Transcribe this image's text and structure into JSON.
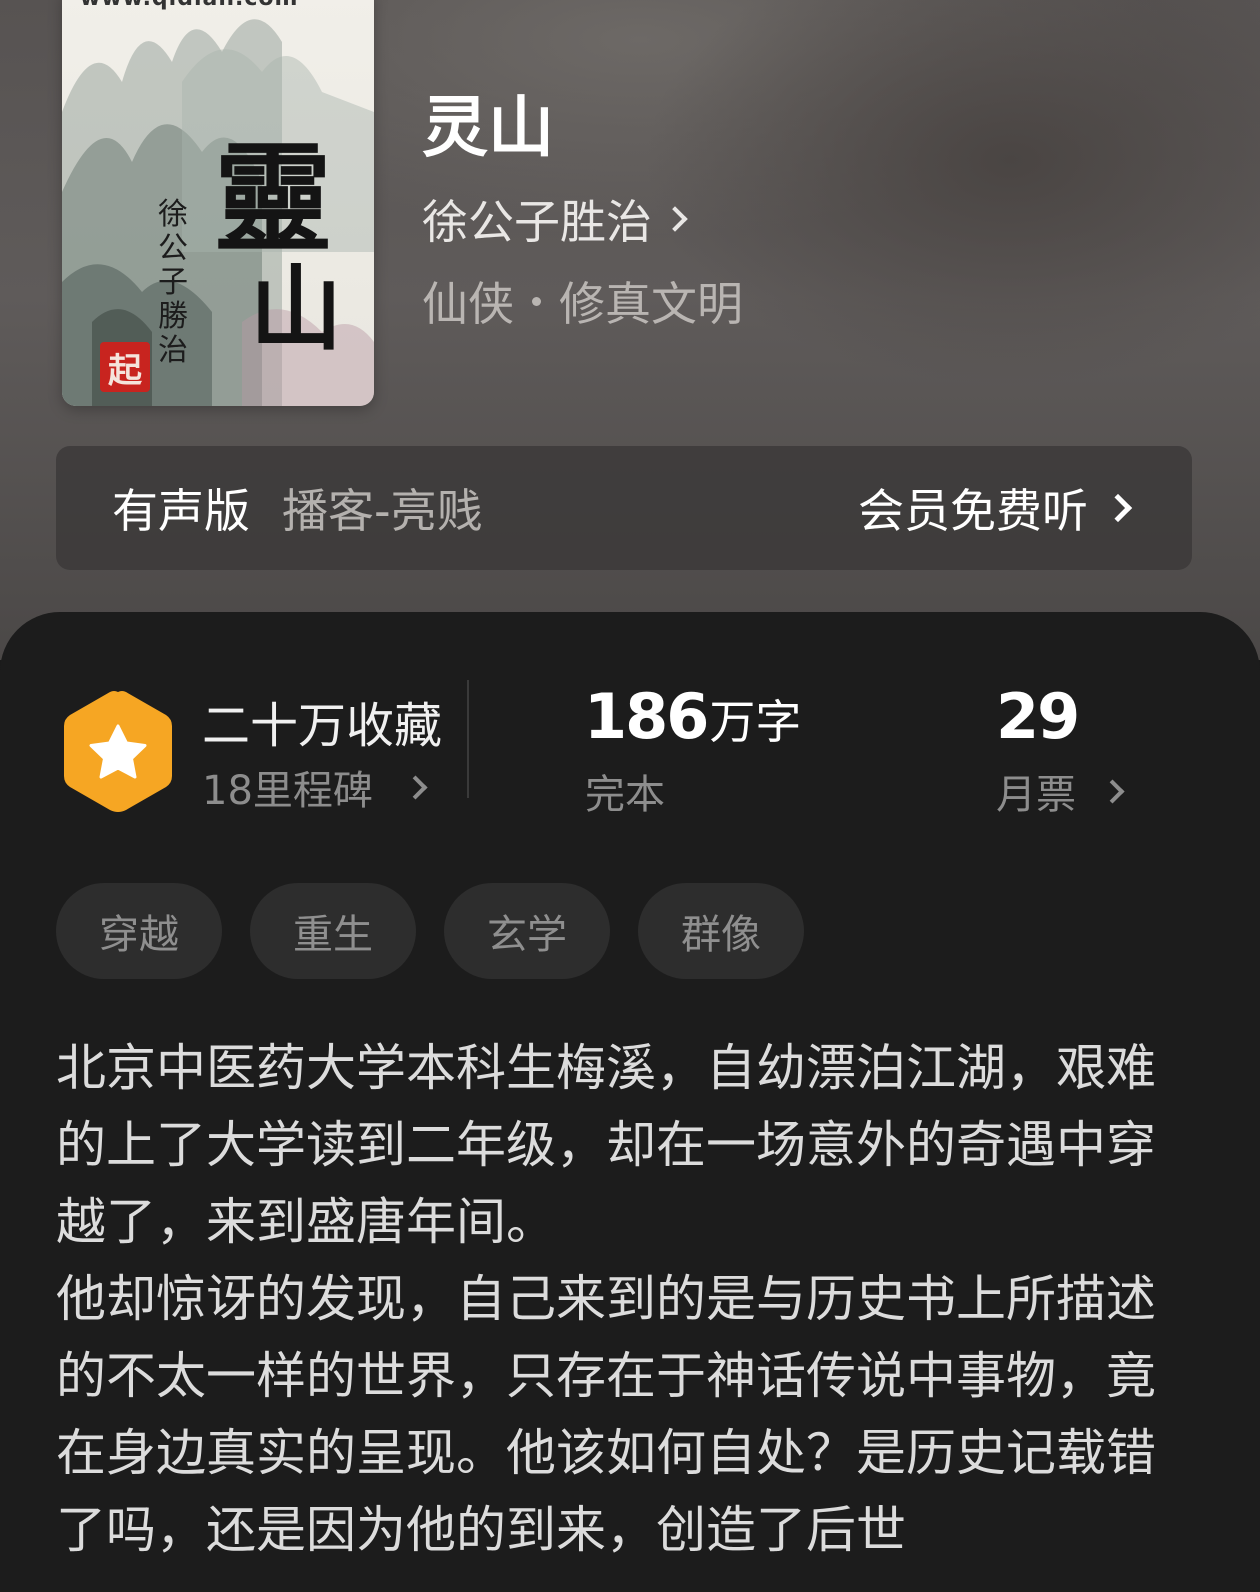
{
  "cover": {
    "site_text": "www.qidian.com",
    "title_line1": "靈",
    "title_line2": "山",
    "author_vertical": "徐公子勝治",
    "seal": "起"
  },
  "book": {
    "title": "灵山",
    "author": "徐公子胜治",
    "genre": "仙侠",
    "subgenre": "修真文明"
  },
  "audio": {
    "label": "有声版",
    "host": "播客-亮贱",
    "action": "会员免费听"
  },
  "stats": {
    "collections": "二十万收藏",
    "milestones": "18里程碑",
    "word_count": "186",
    "word_unit": "万字",
    "status": "完本",
    "monthly_votes": "29",
    "monthly_votes_label": "月票"
  },
  "colors": {
    "badge": "#f6a623",
    "sheet_bg": "#1c1c1c"
  },
  "tags": [
    "穿越",
    "重生",
    "玄学",
    "群像"
  ],
  "description": {
    "para1": "北京中医药大学本科生梅溪，自幼漂泊江湖，艰难的上了大学读到二年级，却在一场意外的奇遇中穿越了，来到盛唐年间。",
    "para2": "他却惊讶的发现，自己来到的是与历史书上所描述的不太一样的世界，只存在于神话传说中事物，竟在身边真实的呈现。他该如何自处？是历史记载错了吗，还是因为他的到来，创造了后世"
  }
}
